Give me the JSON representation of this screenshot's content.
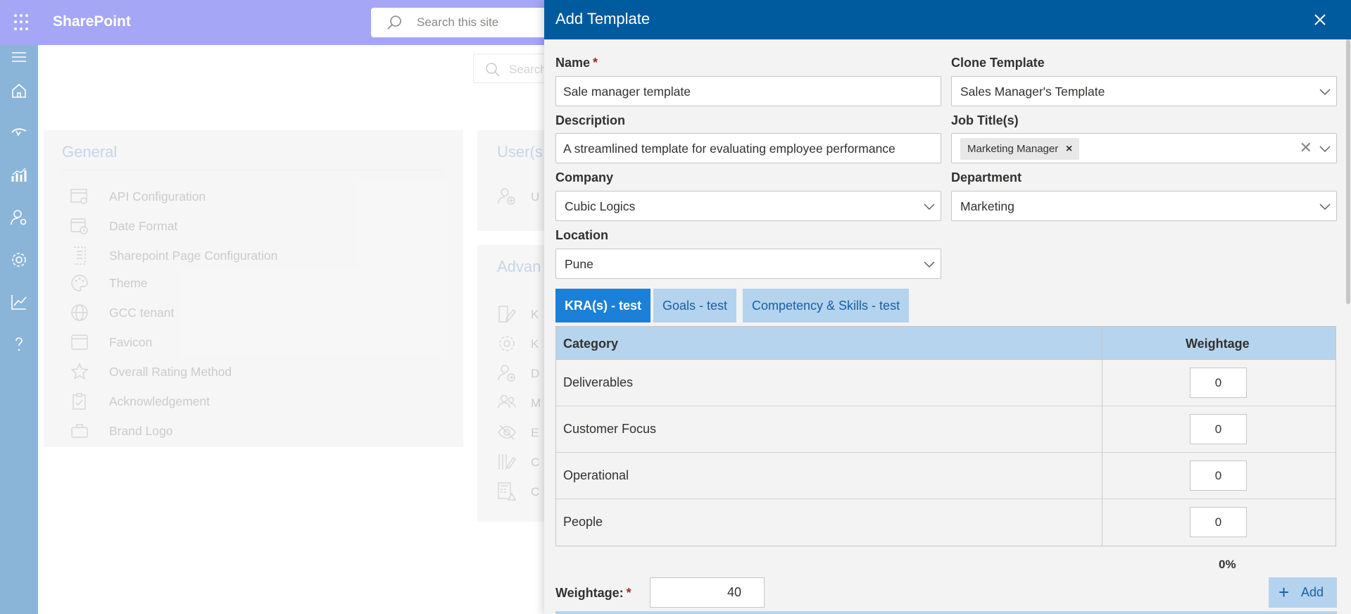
{
  "topbar": {
    "brand": "SharePoint",
    "search_placeholder": "Search this site"
  },
  "background": {
    "search_placeholder": "Search",
    "general": {
      "title": "General",
      "items": [
        {
          "label": "API Configuration",
          "icon": "api-config-icon"
        },
        {
          "label": "Date Format",
          "icon": "calendar-clock-icon"
        },
        {
          "label": "Sharepoint Page Configuration",
          "icon": "page-config-icon"
        },
        {
          "label": "Theme",
          "icon": "palette-icon"
        },
        {
          "label": "GCC tenant",
          "icon": "globe-icon"
        },
        {
          "label": "Favicon",
          "icon": "window-icon"
        },
        {
          "label": "Overall Rating Method",
          "icon": "star-icon"
        },
        {
          "label": "Acknowledgement",
          "icon": "clipboard-check-icon"
        },
        {
          "label": "Brand Logo",
          "icon": "briefcase-icon"
        }
      ]
    },
    "users_card_title": "User(s",
    "users_item_initial": "U",
    "advanced_card_title": "Advan",
    "advanced_item_initials": [
      "K",
      "K",
      "D",
      "M",
      "E",
      "C",
      "C"
    ]
  },
  "panel": {
    "title": "Add Template",
    "name": {
      "label": "Name",
      "value": "Sale manager template"
    },
    "clone": {
      "label": "Clone Template",
      "value": "Sales Manager's Template"
    },
    "description": {
      "label": "Description",
      "value": "A streamlined template for evaluating employee performance"
    },
    "job_titles": {
      "label": "Job Title(s)",
      "tag": "Marketing Manager",
      "tag_remove": "×",
      "clear": "✕"
    },
    "company": {
      "label": "Company",
      "value": "Cubic Logics"
    },
    "department": {
      "label": "Department",
      "value": "Marketing"
    },
    "location": {
      "label": "Location",
      "value": "Pune"
    },
    "required_mark": "*",
    "tabs": [
      "KRA(s) - test",
      "Goals - test",
      "Competency & Skills - test"
    ],
    "table": {
      "headers": {
        "category": "Category",
        "weightage": "Weightage"
      },
      "rows": [
        {
          "category": "Deliverables",
          "weightage": "0"
        },
        {
          "category": "Customer Focus",
          "weightage": "0"
        },
        {
          "category": "Operational",
          "weightage": "0"
        },
        {
          "category": "People",
          "weightage": "0"
        }
      ],
      "total": "0%"
    },
    "weightage": {
      "label": "Weightage:",
      "value": "40"
    },
    "add_button": {
      "plus": "+",
      "label": "Add"
    }
  },
  "colors": {
    "header_blue": "#005a9e",
    "topbar": "#a5a6f6",
    "active_tab": "#1c80d8",
    "table_header": "#b6d4ee"
  }
}
